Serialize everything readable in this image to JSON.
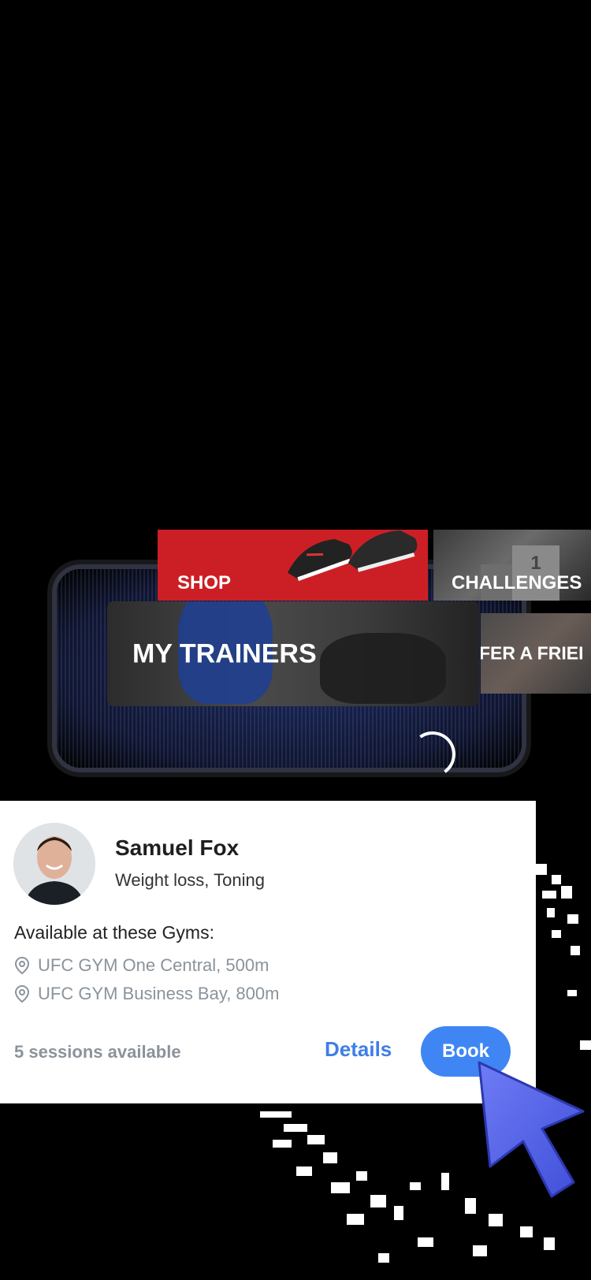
{
  "tiles": {
    "shop_label": "SHOP",
    "challenges_label": "CHALLENGES",
    "trainers_label": "MY TRAINERS",
    "refer_label": "FER A FRIEI"
  },
  "trainer": {
    "name": "Samuel Fox",
    "specialty": "Weight loss, Toning",
    "gyms_heading": "Available at these Gyms:",
    "gyms": [
      "UFC GYM One Central, 500m",
      "UFC GYM Business Bay, 800m"
    ],
    "sessions": "5 sessions available",
    "details_label": "Details",
    "book_label": "Book"
  },
  "icons": [
    "location-pin-icon",
    "avatar",
    "cursor-icon",
    "loading-spinner"
  ],
  "colors": {
    "shop_red": "#cc1f25",
    "accent_blue": "#3f86f4",
    "link_blue": "#3f7ee8",
    "muted_gray": "#8a939c"
  }
}
